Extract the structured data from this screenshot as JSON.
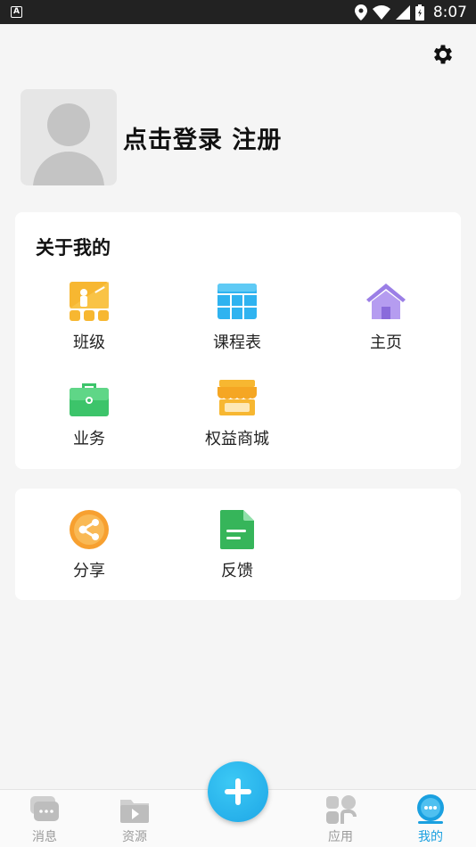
{
  "status_bar": {
    "time": "8:07"
  },
  "profile": {
    "login_text": "点击登录 注册"
  },
  "about_section": {
    "title": "关于我的",
    "items": [
      {
        "label": "班级",
        "icon": "class-icon"
      },
      {
        "label": "课程表",
        "icon": "schedule-icon"
      },
      {
        "label": "主页",
        "icon": "home-icon"
      },
      {
        "label": "业务",
        "icon": "briefcase-icon"
      },
      {
        "label": "权益商城",
        "icon": "store-icon"
      }
    ]
  },
  "extra_section": {
    "items": [
      {
        "label": "分享",
        "icon": "share-icon"
      },
      {
        "label": "反馈",
        "icon": "feedback-icon"
      }
    ]
  },
  "tab_bar": {
    "tabs": [
      {
        "label": "消息",
        "icon": "message-icon"
      },
      {
        "label": "资源",
        "icon": "resource-icon"
      },
      {
        "label": "应用",
        "icon": "apps-icon"
      },
      {
        "label": "我的",
        "icon": "mine-icon",
        "active": true
      }
    ]
  },
  "colors": {
    "accent": "#1aa0e0",
    "class": "#f7b731",
    "schedule": "#2fb3f0",
    "home": "#9b7fe6",
    "business": "#3cc46a",
    "share": "#f7a030",
    "feedback": "#36b55a"
  }
}
